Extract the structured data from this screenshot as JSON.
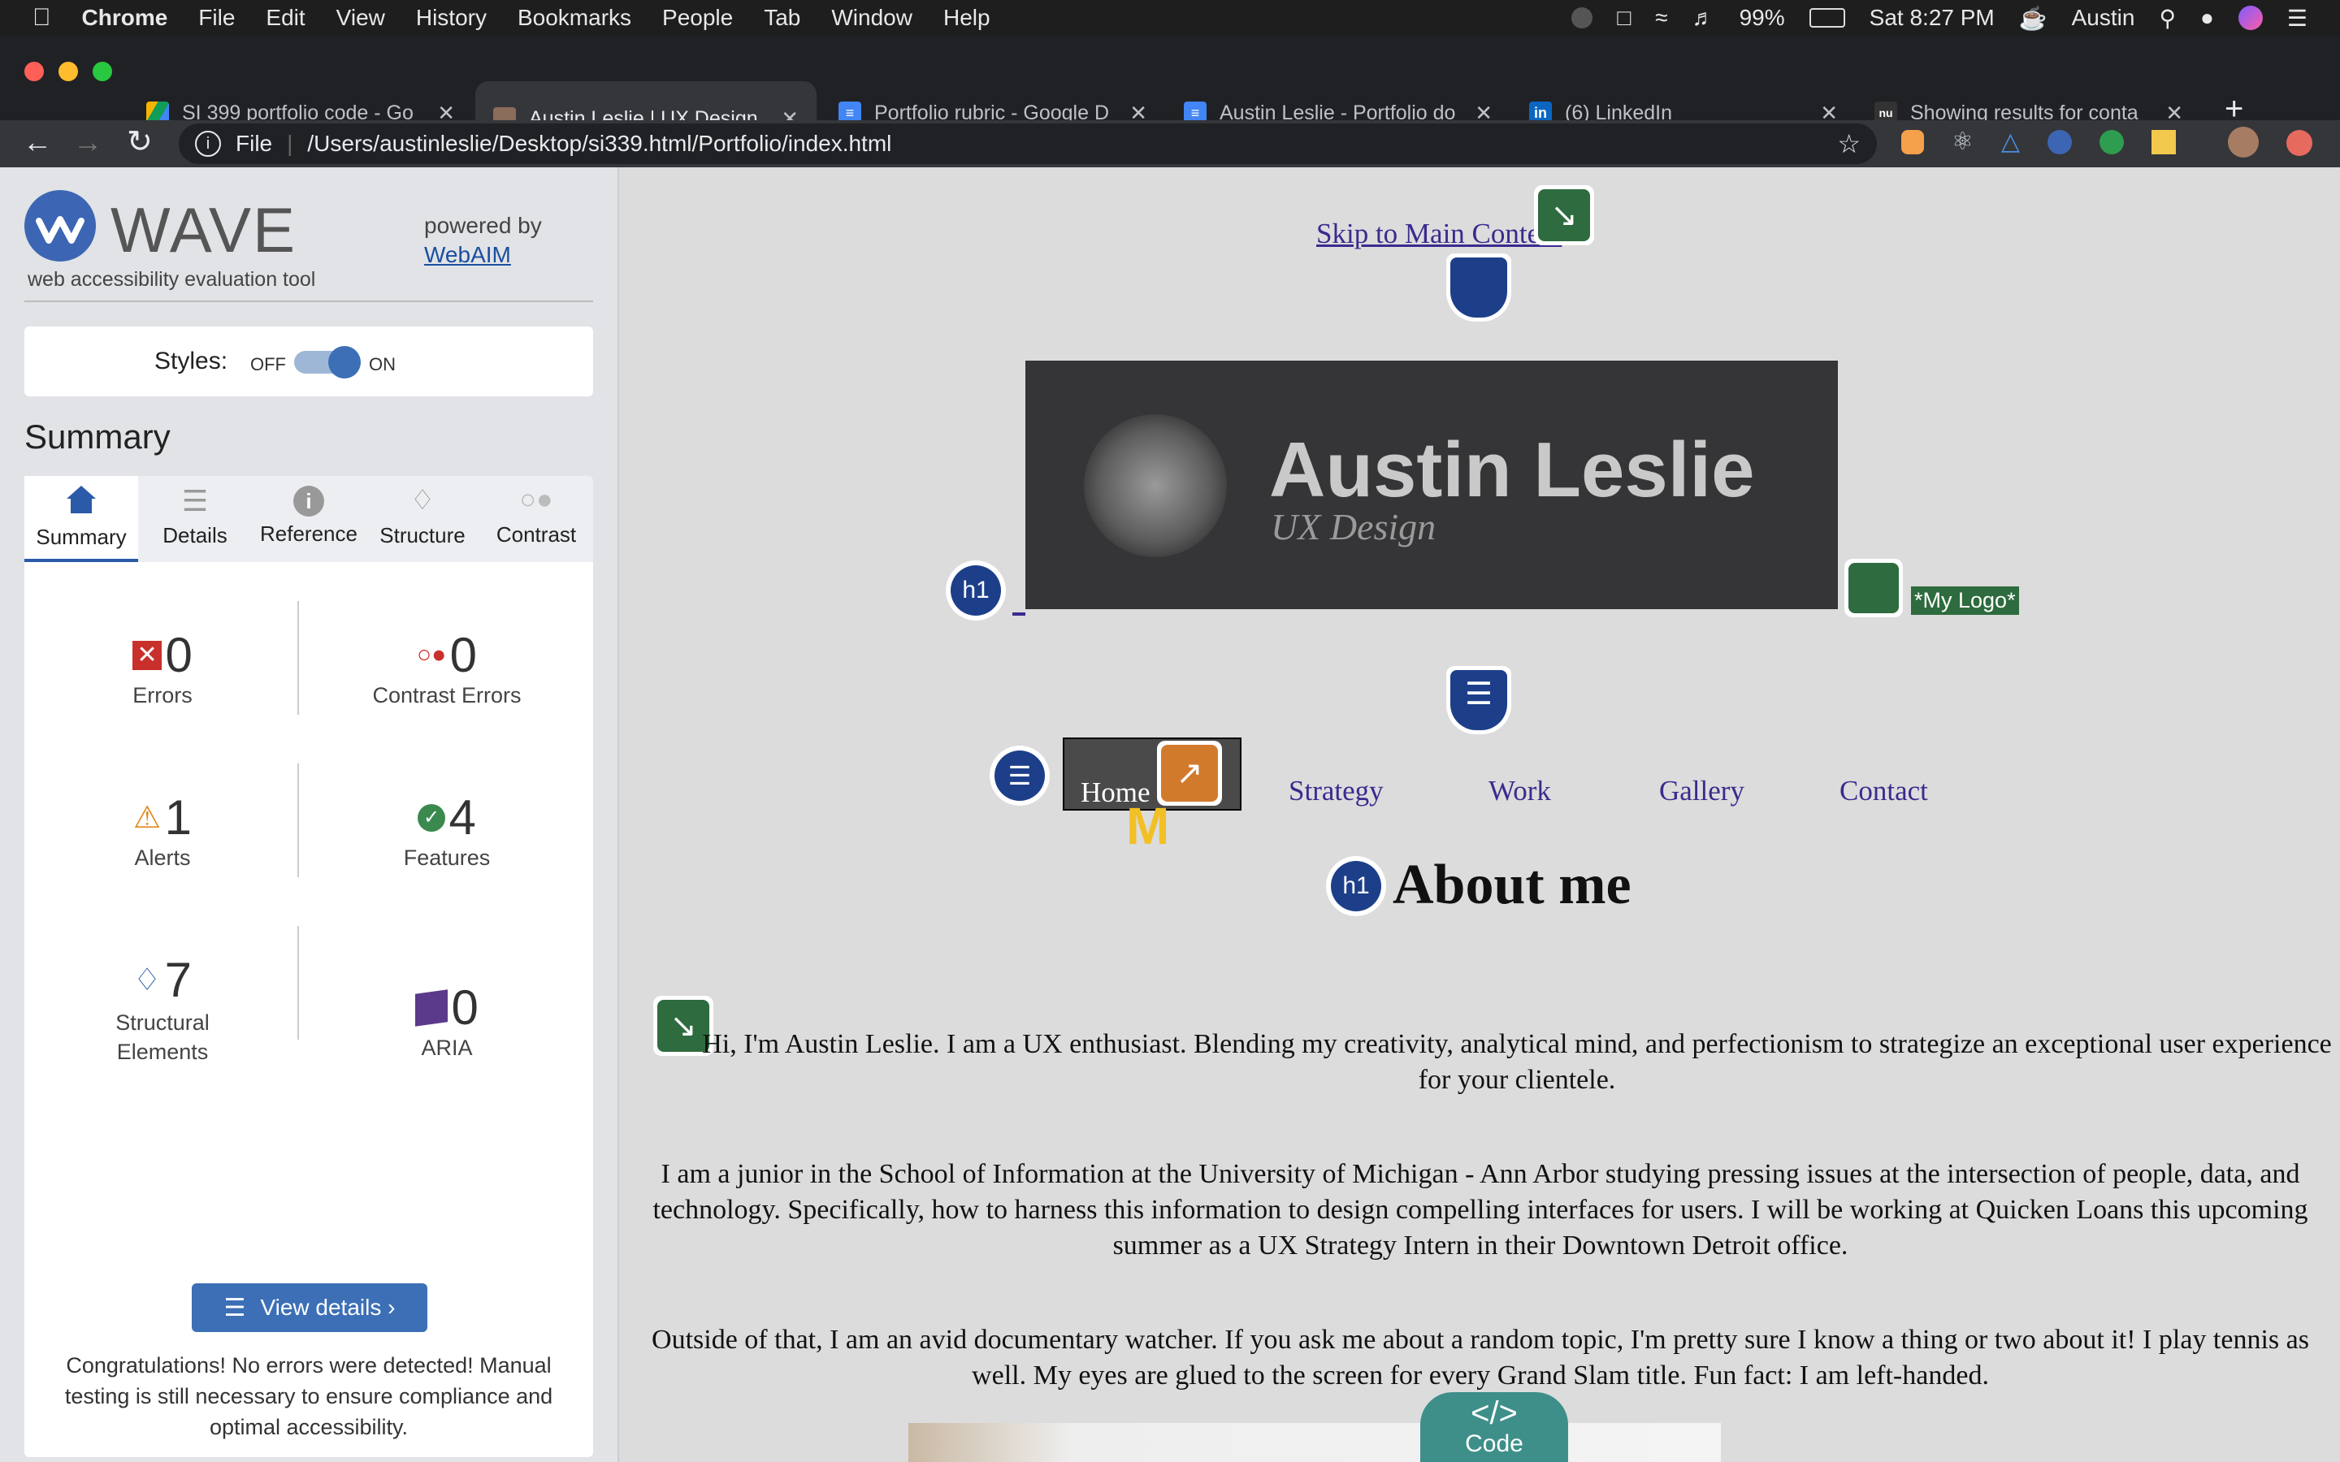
{
  "menubar": {
    "app": "Chrome",
    "items": [
      "File",
      "Edit",
      "View",
      "History",
      "Bookmarks",
      "People",
      "Tab",
      "Window",
      "Help"
    ],
    "battery": "99%",
    "clock": "Sat 8:27 PM",
    "user": "Austin"
  },
  "tabs": [
    {
      "label": "SI 399 portfolio code - Go"
    },
    {
      "label": "Austin Leslie | UX Design"
    },
    {
      "label": "Portfolio rubric - Google D"
    },
    {
      "label": "Austin Leslie - Portfolio do"
    },
    {
      "label": "(6) LinkedIn"
    },
    {
      "label": "Showing results for conta"
    }
  ],
  "address": {
    "scheme": "File",
    "url": "/Users/austinleslie/Desktop/si339.html/Portfolio/index.html"
  },
  "wave": {
    "brand": "WAVE",
    "tagline": "web accessibility evaluation tool",
    "powered_by": "powered by",
    "webaim": "WebAIM",
    "styles_label": "Styles:",
    "off": "OFF",
    "on": "ON",
    "summary_heading": "Summary",
    "tabs": [
      "Summary",
      "Details",
      "Reference",
      "Structure",
      "Contrast"
    ],
    "stats": {
      "errors": {
        "value": "0",
        "label": "Errors"
      },
      "contrast": {
        "value": "0",
        "label": "Contrast Errors"
      },
      "alerts": {
        "value": "1",
        "label": "Alerts"
      },
      "features": {
        "value": "4",
        "label": "Features"
      },
      "structural": {
        "value": "7",
        "label": "Structural Elements"
      },
      "aria": {
        "value": "0",
        "label": "ARIA"
      }
    },
    "view_details": "View details ›",
    "message": "Congratulations! No errors were detected! Manual testing is still necessary to ensure compliance and optimal accessibility."
  },
  "page": {
    "skip_link": "Skip to Main Content",
    "logo_name": "Austin Leslie",
    "logo_sub": "UX Design",
    "logo_alt": "*My Logo*",
    "nav": [
      "Home",
      "Strategy",
      "Work",
      "Gallery",
      "Contact"
    ],
    "heading": "About me",
    "heading_tag": "h1",
    "paragraphs": [
      "Hi, I'm Austin Leslie. I am a UX enthusiast. Blending my creativity, analytical mind, and perfectionism to strategize an exceptional user experience for your clientele.",
      "I am a junior in the School of Information at the University of Michigan - Ann Arbor studying pressing issues at the intersection of people, data, and technology. Specifically, how to harness this information to design compelling interfaces for users. I will be working at Quicken Loans this upcoming summer as a UX Strategy Intern in their Downtown Detroit office.",
      "Outside of that, I am an avid documentary watcher. If you ask me about a random topic, I'm pretty sure I know a thing or two about it! I play tennis as well. My eyes are glued to the screen for every Grand Slam title. Fun fact: I am left-handed."
    ],
    "code_toggle": "Code"
  }
}
